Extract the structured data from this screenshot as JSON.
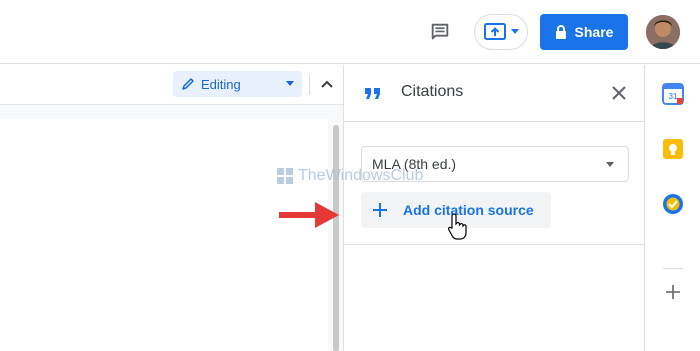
{
  "header": {
    "share_label": "Share"
  },
  "toolbar": {
    "mode_label": "Editing"
  },
  "citations_panel": {
    "title": "Citations",
    "style_value": "MLA (8th ed.)",
    "add_source_label": "Add citation source"
  },
  "watermark": {
    "text": "TheWindowsClub"
  },
  "icons": {
    "comment": "comment-icon",
    "present": "present-to-all-icon",
    "lock": "lock-icon",
    "pencil": "pencil-icon",
    "collapse": "chevron-up-icon",
    "quote": "format-quote-icon",
    "close": "close-icon",
    "plus": "plus-icon",
    "calendar": "google-calendar-icon",
    "keep": "google-keep-icon",
    "tasks": "google-tasks-icon"
  },
  "colors": {
    "accent": "#1a73e8",
    "editing_bg": "#e8f0fe",
    "arrow": "#e53935",
    "calendar_date": "31"
  }
}
